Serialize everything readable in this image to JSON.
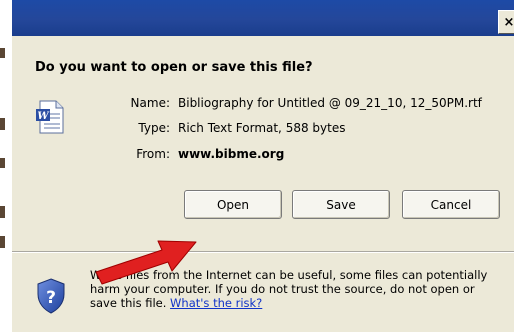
{
  "window": {
    "close_glyph": "×",
    "accent_color": "#1d4aa6",
    "dialog_bg": "#ece9d8"
  },
  "dialog": {
    "heading": "Do you want to open or save this file?",
    "file_icon": "word-document-icon",
    "name_label": "Name:",
    "name_value": "Bibliography for Untitled @ 09_21_10, 12_50PM.rtf",
    "type_label": "Type:",
    "type_value": "Rich Text Format, 588 bytes",
    "from_label": "From:",
    "from_value": "www.bibme.org"
  },
  "buttons": {
    "open": "Open",
    "save": "Save",
    "cancel": "Cancel"
  },
  "warning": {
    "icon": "shield-question-icon",
    "text": "While files from the Internet can be useful, some files can potentially harm your computer. If you do not trust the source, do not open or save this file.",
    "link": "What's the risk?"
  },
  "annotation": {
    "icon": "red-arrow-icon",
    "color": "#e02020"
  }
}
